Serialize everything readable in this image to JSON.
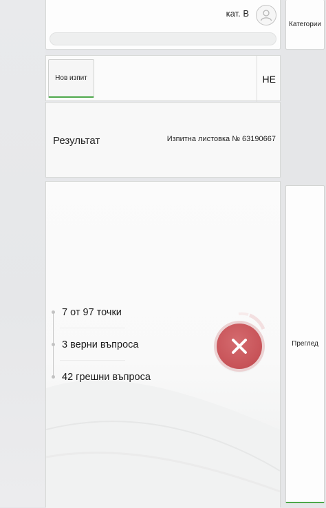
{
  "header": {
    "category": "кат. В",
    "search_placeholder": ""
  },
  "actions": {
    "new_exam": "Нов изпит",
    "answer": "НЕ"
  },
  "result": {
    "title": "Результат",
    "sheet_label": "Изпитна листовка № 63190667"
  },
  "stats": {
    "points": "7 от 97 точки",
    "correct": "3 верни въпроса",
    "wrong": "42 грешни въпроса",
    "status": "fail"
  },
  "side": {
    "categories": "Категории",
    "review": "Преглед"
  },
  "colors": {
    "accent": "#4da84a",
    "fail": "#c85459"
  },
  "icons": {
    "avatar": "user-icon",
    "result": "close-icon"
  }
}
